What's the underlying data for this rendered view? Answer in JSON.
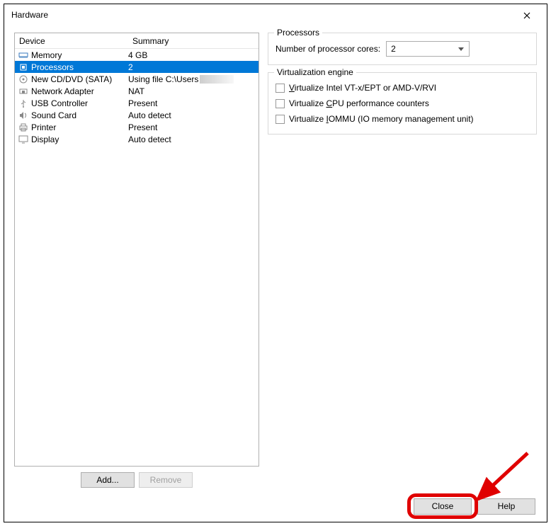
{
  "title": "Hardware",
  "columns": {
    "device": "Device",
    "summary": "Summary"
  },
  "devices": [
    {
      "icon": "memory",
      "name": "Memory",
      "summary": "4 GB",
      "selected": false
    },
    {
      "icon": "cpu",
      "name": "Processors",
      "summary": "2",
      "selected": true
    },
    {
      "icon": "disc",
      "name": "New CD/DVD (SATA)",
      "summary": "Using file C:\\Users",
      "selected": false,
      "smudge": true
    },
    {
      "icon": "net",
      "name": "Network Adapter",
      "summary": "NAT",
      "selected": false
    },
    {
      "icon": "usb",
      "name": "USB Controller",
      "summary": "Present",
      "selected": false
    },
    {
      "icon": "sound",
      "name": "Sound Card",
      "summary": "Auto detect",
      "selected": false
    },
    {
      "icon": "printer",
      "name": "Printer",
      "summary": "Present",
      "selected": false
    },
    {
      "icon": "display",
      "name": "Display",
      "summary": "Auto detect",
      "selected": false
    }
  ],
  "buttons": {
    "add": "Add...",
    "remove": "Remove",
    "close": "Close",
    "help": "Help"
  },
  "right": {
    "processors_group": "Processors",
    "cores_label": "Number of processor cores:",
    "cores_value": "2",
    "virt_group": "Virtualization engine",
    "chk1_pre": "V",
    "chk1_rest": "irtualize Intel VT-x/EPT or AMD-V/RVI",
    "chk2_pre": "Virtualize ",
    "chk2_u": "C",
    "chk2_rest": "PU performance counters",
    "chk3_pre": "Virtualize ",
    "chk3_u": "I",
    "chk3_rest": "OMMU (IO memory management unit)"
  }
}
